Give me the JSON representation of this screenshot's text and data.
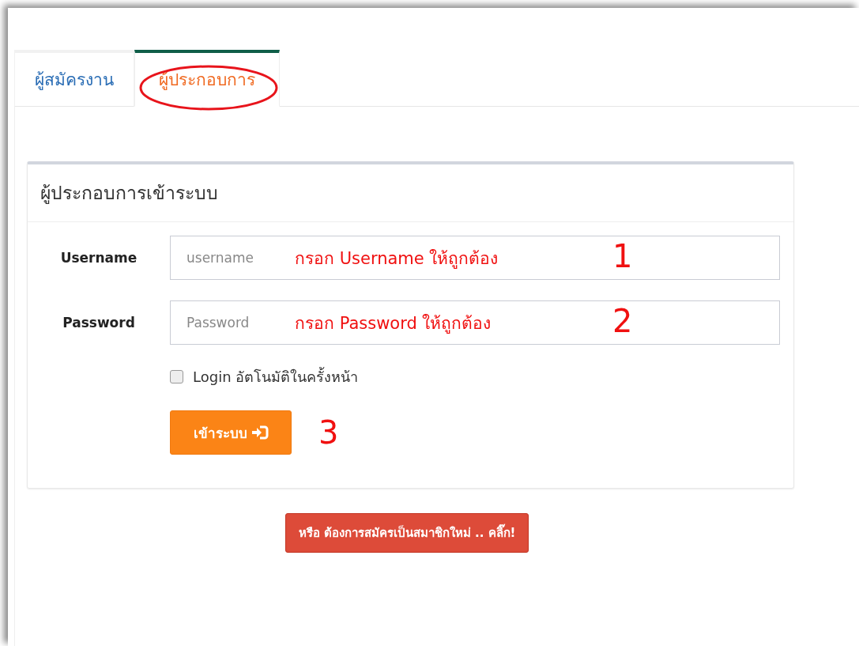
{
  "tabs": [
    {
      "label": "ผู้สมัครงาน",
      "selected": false,
      "circled": false
    },
    {
      "label": "ผู้ประกอบการ",
      "selected": true,
      "circled": true
    }
  ],
  "login_panel": {
    "title": "ผู้ประกอบการเข้าระบบ",
    "fields": [
      {
        "label": "Username",
        "placeholder": "username",
        "note": "กรอก Username ให้ถูกต้อง",
        "step": "1"
      },
      {
        "label": "Password",
        "placeholder": "Password",
        "note": "กรอก Password ให้ถูกต้อง",
        "step": "2"
      }
    ],
    "remember": {
      "label": "Login อัตโนมัติในครั้งหน้า",
      "checked": false
    },
    "submit": {
      "label": "เข้าระบบ",
      "step": "3"
    }
  },
  "register_button": "หรือ ต้องการสมัครเป็นสมาชิกใหม่ .. คลิ๊ก!"
}
